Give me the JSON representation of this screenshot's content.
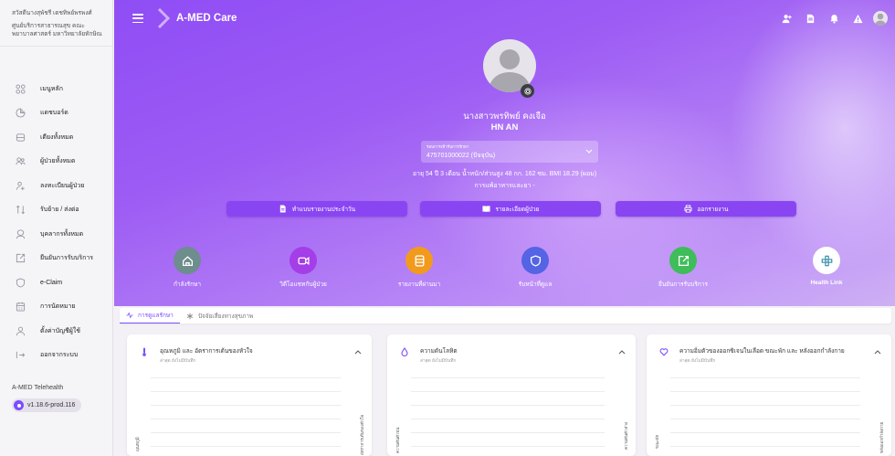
{
  "sidebar": {
    "org_line1": "สวัสดีนางสุพัชรี เดชทิพย์พรพงศ์",
    "org_line2": "ศูนย์บริการสาธารณสุข คณะ",
    "org_line3": "พยาบาลศาสตร์ มหาวิทยาลัยทักษิณ",
    "items": [
      {
        "label": "เมนูหลัก",
        "icon": "grid-icon"
      },
      {
        "label": "แดชบอร์ด",
        "icon": "dashboard-icon"
      },
      {
        "label": "เตียงทั้งหมด",
        "icon": "bed-icon"
      },
      {
        "label": "ผู้ป่วยทั้งหมด",
        "icon": "patients-icon"
      },
      {
        "label": "ลงทะเบียนผู้ป่วย",
        "icon": "register-icon"
      },
      {
        "label": "รับย้าย / ส่งต่อ",
        "icon": "transfer-icon"
      },
      {
        "label": "บุคลากรทั้งหมด",
        "icon": "staff-icon"
      },
      {
        "label": "ยืนยันการรับบริการ",
        "icon": "confirm-icon"
      },
      {
        "label": "e-Claim",
        "icon": "shield-icon"
      },
      {
        "label": "การนัดหมาย",
        "icon": "calendar-icon"
      },
      {
        "label": "ตั้งค่าบัญชีผู้ใช้",
        "icon": "user-settings-icon"
      },
      {
        "label": "ออกจากระบบ",
        "icon": "logout-icon"
      }
    ],
    "app_name": "A-MED Telehealth",
    "version": "v1.18.6-prod.116"
  },
  "header": {
    "title": "A-MED Care"
  },
  "patient": {
    "name": "นางสาวพรทิพย์ คงเจือ",
    "hn": "HN AN",
    "visit_label": "รอบการเข้ารับการรักษา",
    "visit_value": "475701000022 (ปัจจุบัน)",
    "info": "อายุ 54 ปี 3 เดือน น้ำหนัก/ส่วนสูง 48 กก. 162 ซม. BMI 18.29 (ผอม)",
    "allergy": "การแพ้อาหารและยา -"
  },
  "actions": [
    {
      "label": "ทำแบบรายงานประจำวัน",
      "icon": "document-icon"
    },
    {
      "label": "รายละเอียดผู้ป่วย",
      "icon": "book-icon"
    },
    {
      "label": "ออกรายงาน",
      "icon": "printer-icon"
    }
  ],
  "quick": [
    {
      "label": "กำลังรักษา",
      "icon": "home-icon",
      "color": "#6e8d8d"
    },
    {
      "label": "วิดีโอแชทกับผู้ป่วย",
      "icon": "video-icon",
      "color": "#a43ee8"
    },
    {
      "label": "รายงานที่ผ่านมา",
      "icon": "report-icon",
      "color": "#f29a1c"
    },
    {
      "label": "รับหน้าที่ดูแล",
      "icon": "shield-check-icon",
      "color": "#5563e5"
    },
    {
      "label": "ยืนยันการรับบริการ",
      "icon": "external-link-icon",
      "color": "#3ebd5a"
    },
    {
      "label": "Health Link",
      "icon": "health-link-icon",
      "color": "#ffffff"
    }
  ],
  "tabs": [
    {
      "label": "การดูแลรักษา",
      "icon": "pulse-icon",
      "active": true
    },
    {
      "label": "ปัจจัยเสี่ยงทางสุขภาพ",
      "icon": "asterisk-icon",
      "active": false
    }
  ],
  "cards": [
    {
      "title": "อุณหภูมิ และ อัตราการเต้นของหัวใจ",
      "sub": "ล่าสุด ยังไม่มีบันทึก",
      "icon": "thermometer-icon",
      "ylabel_left": "อุณหภูมิ",
      "ylabel_right": "อัตราการเต้นของหัวใจ"
    },
    {
      "title": "ความดันโลหิต",
      "sub": "ล่าสุด ยังไม่มีบันทึก",
      "icon": "drop-icon",
      "ylabel_left": "ความดันตัวบน",
      "ylabel_right": "ความดันตัวล่าง"
    },
    {
      "title": "ความอิ่มตัวของออกซิเจนในเลือด ขณะพัก และ หลังออกกำลังกาย",
      "sub": "ล่าสุด ยังไม่มีบันทึก",
      "icon": "heart-icon",
      "ylabel_left": "ขณะพัก",
      "ylabel_right": "หลังออกกำลังกาย"
    }
  ]
}
